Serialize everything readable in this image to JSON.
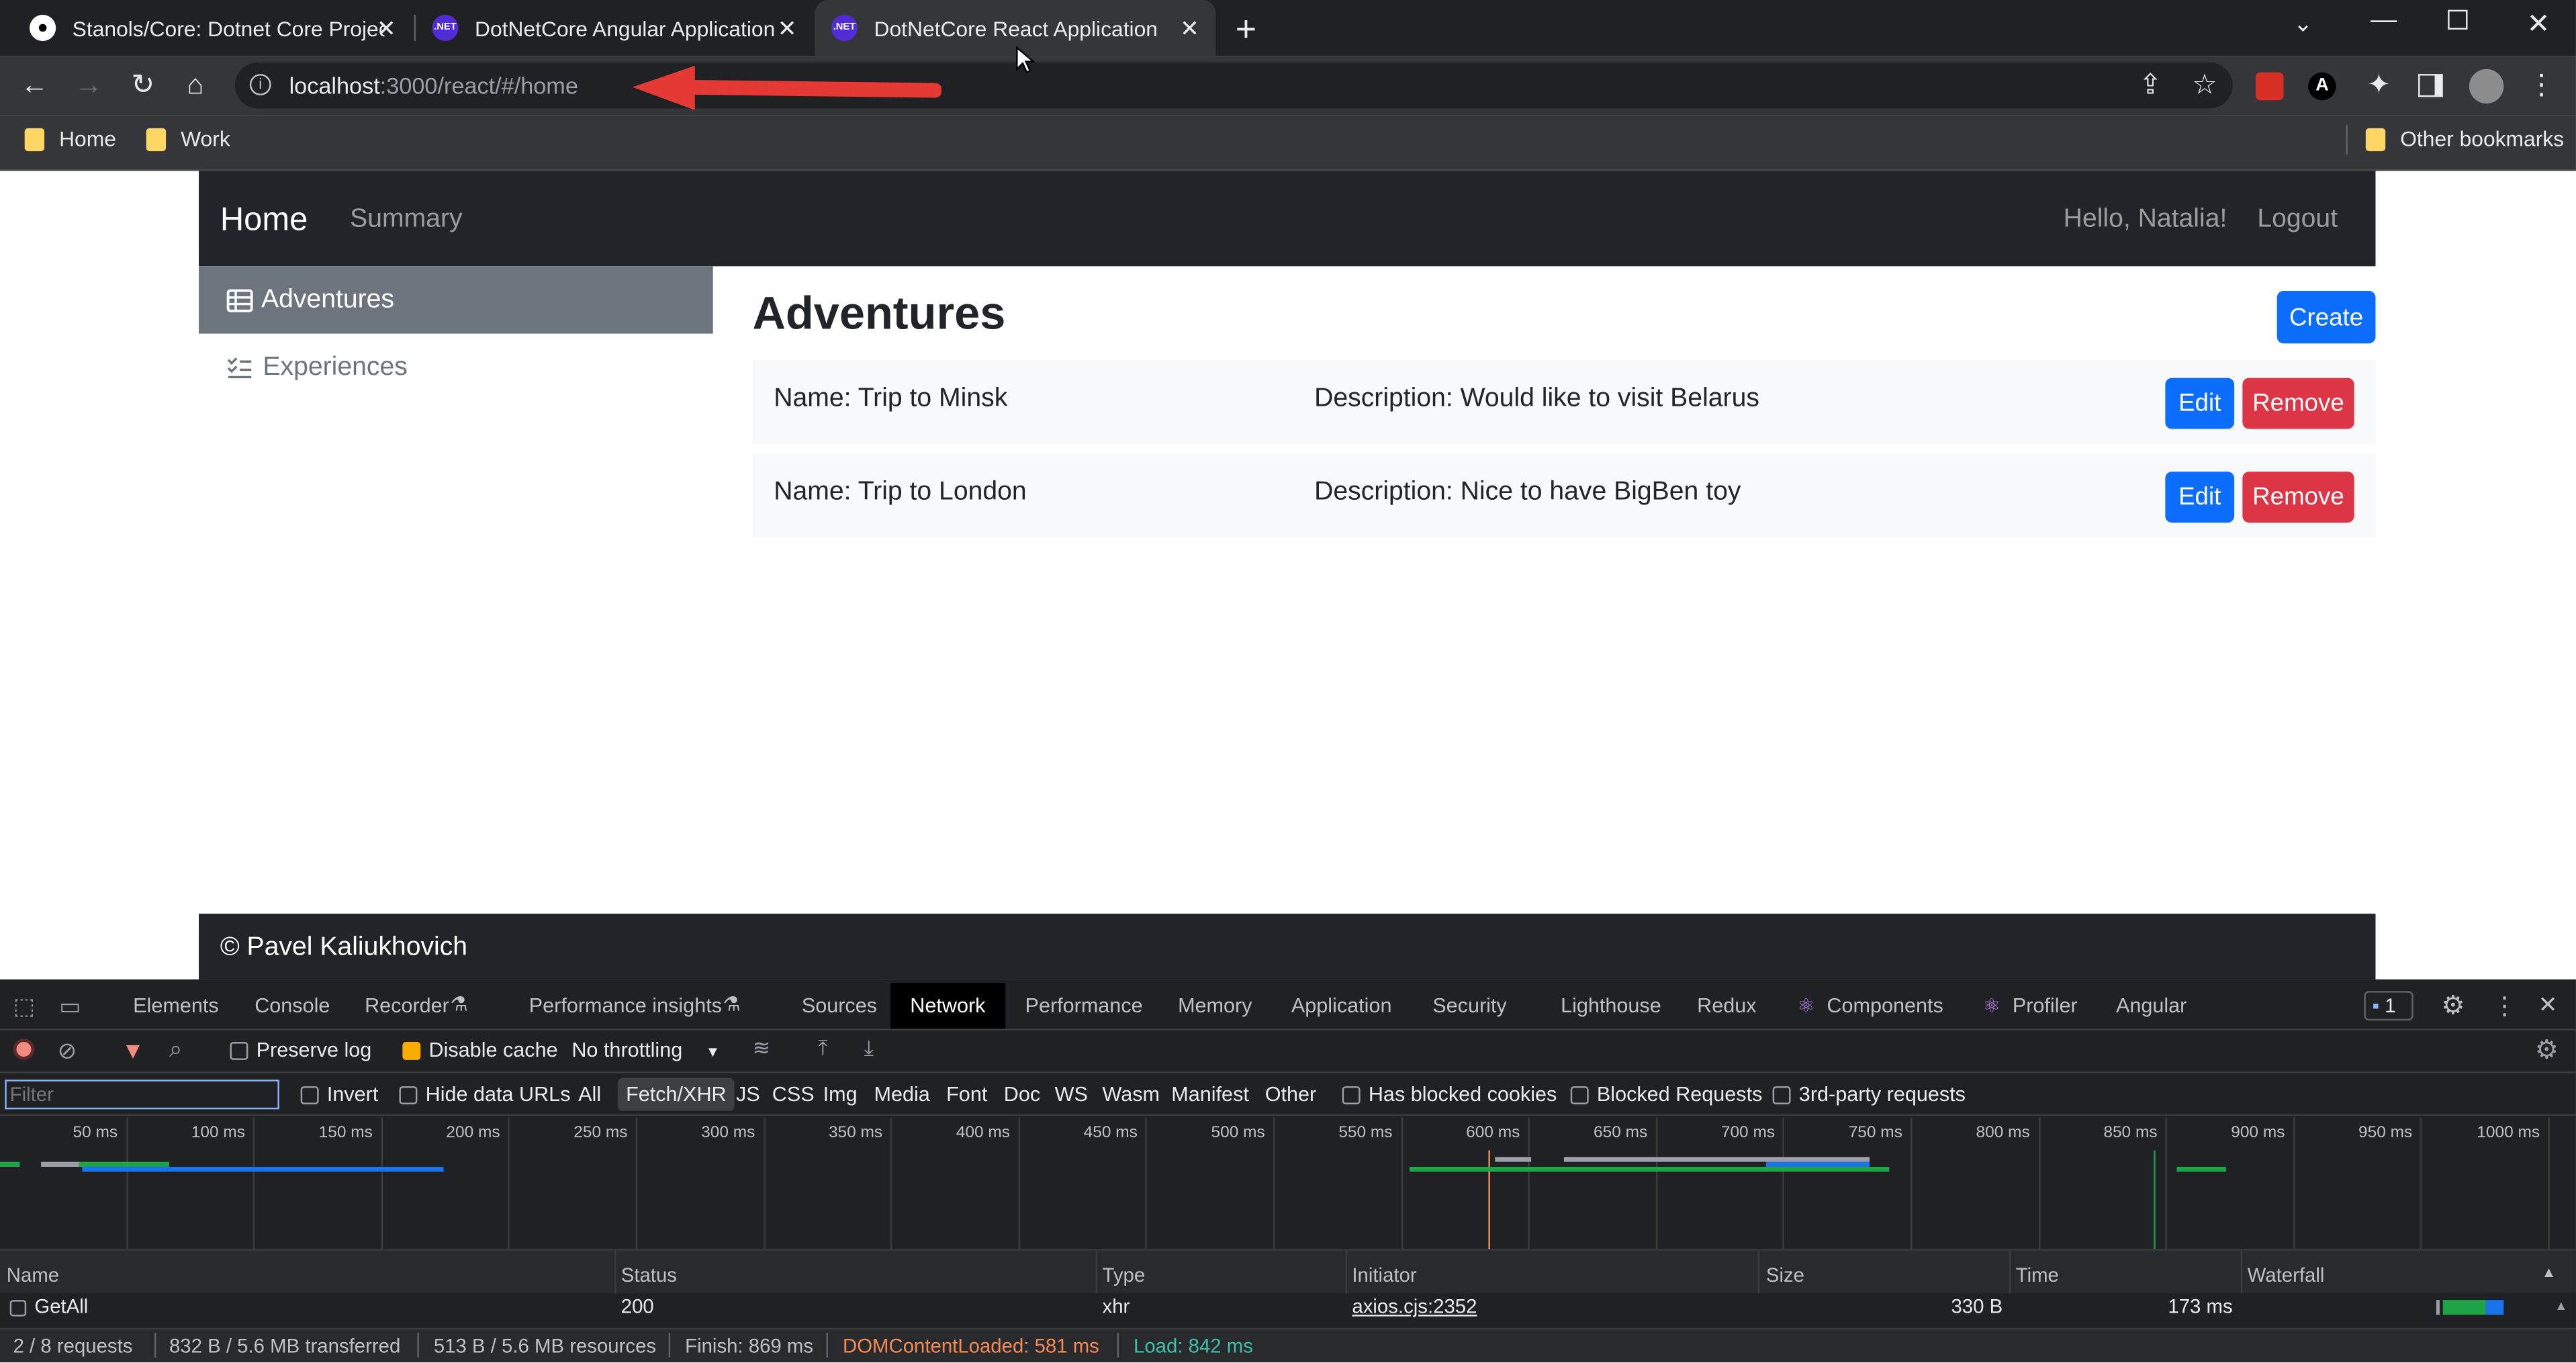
{
  "browser": {
    "tabs": [
      {
        "title": "Stanols/Core: Dotnet Core Projec",
        "favicon": "github-icon"
      },
      {
        "title": "DotNetCore Angular Application",
        "favicon": "dotnet-icon"
      },
      {
        "title": "DotNetCore React Application",
        "favicon": "dotnet-icon",
        "active": true
      }
    ],
    "url_host": "localhost",
    "url_path": ":3000/react/#/home",
    "bookmarks": [
      "Home",
      "Work"
    ],
    "other_bookmarks": "Other bookmarks",
    "favicon_text": ".NET"
  },
  "navbar": {
    "brand": "Home",
    "links": [
      "Summary"
    ],
    "greeting": "Hello, Natalia!",
    "logout": "Logout"
  },
  "sidebar": {
    "items": [
      {
        "label": "Adventures",
        "icon": "table-icon",
        "active": true
      },
      {
        "label": "Experiences",
        "icon": "list-check-icon"
      }
    ]
  },
  "main": {
    "title": "Adventures",
    "create": "Create",
    "rows": [
      {
        "name": "Name: Trip to Minsk",
        "description": "Description: Would like to visit Belarus",
        "edit": "Edit",
        "remove": "Remove"
      },
      {
        "name": "Name: Trip to London",
        "description": "Description: Nice to have BigBen toy",
        "edit": "Edit",
        "remove": "Remove"
      }
    ]
  },
  "footer": {
    "text": "© Pavel Kaliukhovich"
  },
  "devtools": {
    "tabs": [
      "Elements",
      "Console",
      "Recorder",
      "Performance insights",
      "Sources",
      "Network",
      "Performance",
      "Memory",
      "Application",
      "Security",
      "Lighthouse",
      "Redux",
      "Components",
      "Profiler",
      "Angular"
    ],
    "active_tab": "Network",
    "issues_count": "1",
    "preserve_log": "Preserve log",
    "disable_cache": "Disable cache",
    "throttling": "No throttling",
    "filter_placeholder": "Filter",
    "invert": "Invert",
    "hide_data_urls": "Hide data URLs",
    "type_filters": [
      "All",
      "Fetch/XHR",
      "JS",
      "CSS",
      "Img",
      "Media",
      "Font",
      "Doc",
      "WS",
      "Wasm",
      "Manifest",
      "Other"
    ],
    "active_type_filter": "Fetch/XHR",
    "blocked_cookies": "Has blocked cookies",
    "blocked_requests": "Blocked Requests",
    "third_party": "3rd-party requests",
    "timeline_ticks": [
      "50 ms",
      "100 ms",
      "150 ms",
      "200 ms",
      "250 ms",
      "300 ms",
      "350 ms",
      "400 ms",
      "450 ms",
      "500 ms",
      "550 ms",
      "600 ms",
      "650 ms",
      "700 ms",
      "750 ms",
      "800 ms",
      "850 ms",
      "900 ms",
      "950 ms",
      "1000 ms"
    ],
    "columns": [
      "Name",
      "Status",
      "Type",
      "Initiator",
      "Size",
      "Time",
      "Waterfall"
    ],
    "requests": [
      {
        "name": "GetAll",
        "status": "200",
        "type": "xhr",
        "initiator": "axios.cjs:2352",
        "size": "330 B",
        "time": "173 ms"
      }
    ],
    "summary": {
      "requests": "2 / 8 requests",
      "transferred": "832 B / 5.6 MB transferred",
      "resources": "513 B / 5.6 MB resources",
      "finish": "Finish: 869 ms",
      "dom_loaded": "DOMContentLoaded: 581 ms",
      "load": "Load: 842 ms"
    },
    "colors": {
      "dom_loaded": "#f28b54",
      "load": "#1ea446"
    }
  }
}
